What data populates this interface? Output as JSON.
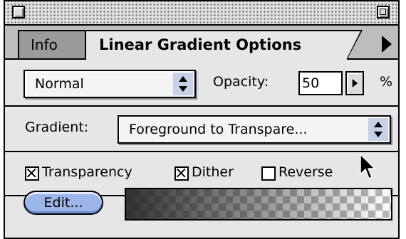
{
  "tabs": {
    "info_label": "Info",
    "active_label": "Linear Gradient Options"
  },
  "mode": {
    "selected": "Normal"
  },
  "opacity": {
    "label": "Opacity:",
    "value": "50",
    "unit": "%"
  },
  "gradient": {
    "label": "Gradient:",
    "selected": "Foreground to Transpare..."
  },
  "options": {
    "transparency": {
      "label": "Transparency",
      "checked": true
    },
    "dither": {
      "label": "Dither",
      "checked": true
    },
    "reverse": {
      "label": "Reverse",
      "checked": false
    }
  },
  "edit_button": {
    "label": "Edit..."
  },
  "colors": {
    "panel": "#e6e6e6",
    "edit_button": "#9db6ea",
    "stepper": "#c8d0e8"
  }
}
